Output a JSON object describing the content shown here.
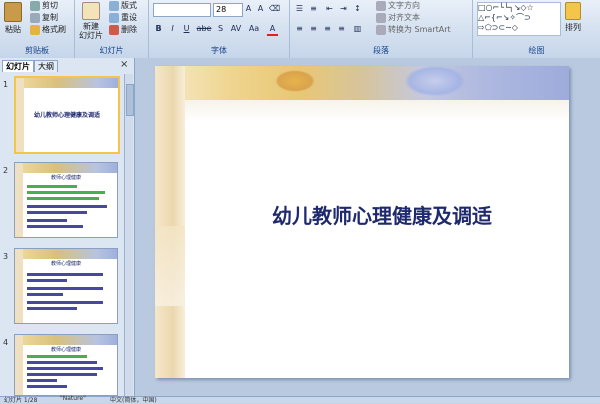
{
  "ribbon": {
    "clipboard": {
      "group_label": "剪贴板",
      "paste_label": "粘贴",
      "cut_label": "剪切",
      "copy_label": "复制",
      "format_painter_label": "格式刷"
    },
    "slides": {
      "group_label": "幻灯片",
      "new_slide_label": "新建\n幻灯片",
      "layout_label": "版式",
      "reset_label": "重设",
      "delete_label": "删除"
    },
    "font": {
      "group_label": "字体",
      "font_size": "28",
      "bold": "B",
      "italic": "I",
      "underline": "U",
      "strike": "abe",
      "shadow": "S",
      "spacing": "AV",
      "case": "Aa",
      "color": "A"
    },
    "paragraph": {
      "group_label": "段落",
      "text_direction_label": "文字方向",
      "align_text_label": "对齐文本",
      "smartart_label": "转换为 SmartArt"
    },
    "drawing": {
      "group_label": "绘图",
      "arrange_label": "排列"
    }
  },
  "left_panel": {
    "tab_slides": "幻灯片",
    "tab_outline": "大纲",
    "close": "×",
    "thumbnails": [
      {
        "num": "1",
        "title": "幼儿教师心理健康及调适"
      },
      {
        "num": "2",
        "title": "教师心理健康"
      },
      {
        "num": "3",
        "title": "教师心理健康"
      },
      {
        "num": "4",
        "title": "教师心理健康"
      }
    ]
  },
  "slide": {
    "title": "幼儿教师心理健康及调适"
  },
  "status": {
    "slide_info": "幻灯片 1/28",
    "theme": "\"Nature\"",
    "lang": "中文(简体，中国)"
  },
  "colors": {
    "title": "#1f2a6e",
    "ribbon_label": "#15428b",
    "accent": "#f3c64a"
  }
}
